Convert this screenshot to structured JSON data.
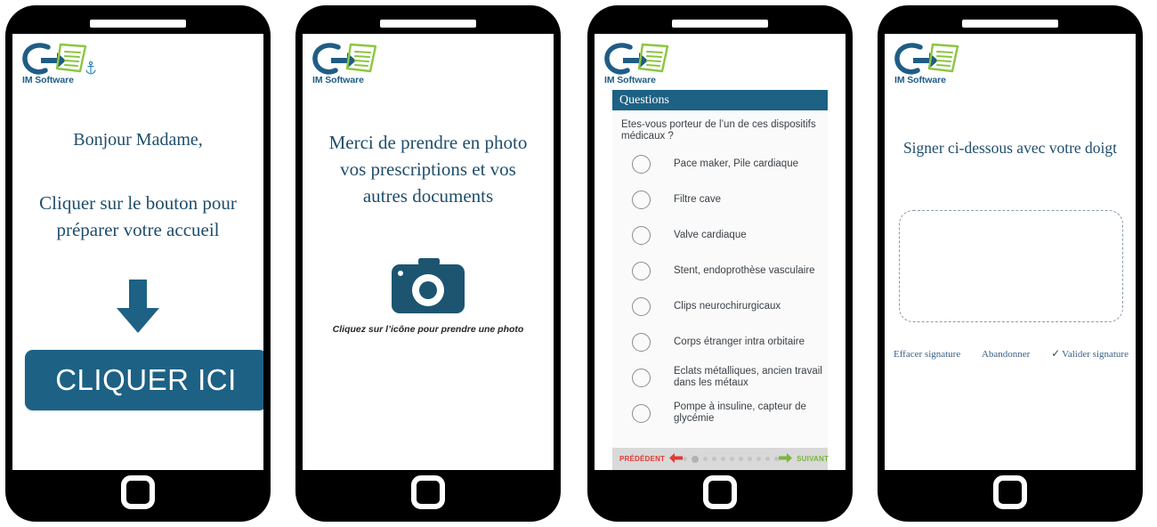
{
  "brand": {
    "name": "IM Software",
    "logo_icon": "im-software-logo",
    "colors": {
      "blue": "#1f5d86",
      "green": "#8cc63f",
      "teal": "#1d6184",
      "text_blue": "#1f4e6b"
    }
  },
  "screen1": {
    "anchor_icon": "anchor-icon",
    "greeting": "Bonjour Madame,",
    "instruction": "Cliquer sur le bouton pour préparer votre accueil",
    "arrow_icon": "down-arrow-icon",
    "button_label": "CLIQUER ICI"
  },
  "screen2": {
    "title": "Merci de prendre en photo vos prescriptions et vos autres documents",
    "camera_icon": "camera-icon",
    "caption": "Cliquez sur l’icône pour prendre une photo"
  },
  "screen3": {
    "header": "Questions",
    "question": "Etes-vous porteur de l’un de ces dispositifs médicaux ?",
    "options": [
      "Pace maker, Pile cardiaque",
      "Filtre cave",
      "Valve cardiaque",
      "Stent, endoprothèse vasculaire",
      "Clips neurochirurgicaux",
      "Corps étranger intra orbitaire",
      "Eclats métalliques, ancien travail dans les métaux",
      "Pompe à insuline, capteur de glycémie"
    ],
    "nav": {
      "prev_label": "PRÉDÉDENT",
      "prev_icon": "arrow-left-icon",
      "next_label": "SUIVANT",
      "next_icon": "arrow-right-icon",
      "dots_total": 11,
      "dots_active_index": 1
    }
  },
  "screen4": {
    "title": "Signer ci-dessous avec votre doigt",
    "signature_pad_placeholder": "",
    "actions": [
      {
        "label": "Effacer signature",
        "icon": ""
      },
      {
        "label": "Abandonner",
        "icon": ""
      },
      {
        "label": "Valider signature",
        "icon": "check-icon"
      }
    ]
  }
}
